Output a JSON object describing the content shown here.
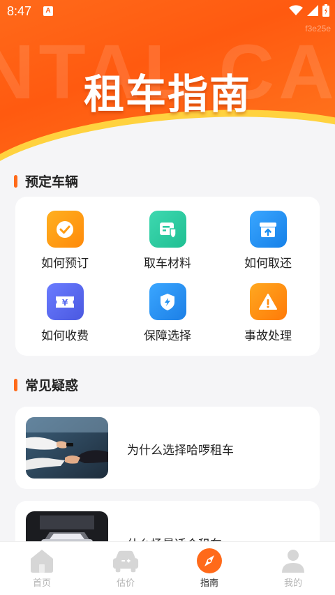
{
  "status_bar": {
    "time": "8:47",
    "app_letter": "A"
  },
  "header": {
    "title": "租车指南",
    "background_text": "NTAL CAR",
    "watermark": "f3e25e"
  },
  "booking_section": {
    "title": "预定车辆",
    "items": [
      {
        "label": "如何预订",
        "icon": "check-icon",
        "color": "#ff9d14"
      },
      {
        "label": "取车材料",
        "icon": "documents-icon",
        "color": "#2ccaa0"
      },
      {
        "label": "如何取还",
        "icon": "return-box-icon",
        "color": "#1e90f0"
      },
      {
        "label": "如何收费",
        "icon": "yen-ticket-icon",
        "color": "#5a6cf0"
      },
      {
        "label": "保障选择",
        "icon": "shield-bolt-icon",
        "color": "#2a95f0"
      },
      {
        "label": "事故处理",
        "icon": "warning-icon",
        "color": "#ff8c10"
      }
    ]
  },
  "faq_section": {
    "title": "常见疑惑",
    "items": [
      {
        "question": "为什么选择哈啰租车",
        "thumbnail": "car-key-handover-image"
      },
      {
        "question": "什么场景适合租车",
        "thumbnail": "car-showroom-image"
      }
    ]
  },
  "bottom_nav": {
    "items": [
      {
        "label": "首页",
        "icon": "home-icon",
        "active": false
      },
      {
        "label": "估价",
        "icon": "car-estimate-icon",
        "active": false
      },
      {
        "label": "指南",
        "icon": "compass-icon",
        "active": true
      },
      {
        "label": "我的",
        "icon": "profile-icon",
        "active": false
      }
    ]
  },
  "colors": {
    "accent": "#ff6a1a",
    "yellow": "#ffd23f"
  }
}
